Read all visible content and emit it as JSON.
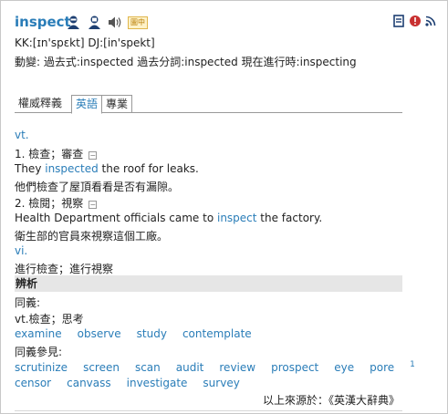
{
  "entry": {
    "headword": "inspect",
    "badge": "圖中",
    "pron": "KK:[ɪn'spɛkt] DJ:[in'spekt]",
    "inflections": "動變: 過去式:inspected  過去分詞:inspected  現在進行時:inspecting"
  },
  "tabs": [
    "權威釋義",
    "英語",
    "專業"
  ],
  "sense1": {
    "pos": "vt.",
    "def": "1. 檢查；審查",
    "ex_pre": "They ",
    "ex_kw": "inspected",
    "ex_post": " the roof for leaks.",
    "ex_zh": "他們檢查了屋頂看看是否有漏隙。"
  },
  "sense2": {
    "def": "2. 檢閱；視察",
    "ex_pre": "Health Department officials came to ",
    "ex_kw": "inspect",
    "ex_post": " the factory.",
    "ex_zh": "衛生部的官員來視察這個工廠。"
  },
  "sense3": {
    "pos": "vi.",
    "def": "進行檢查；進行視察"
  },
  "analysis": {
    "title": "辨析",
    "syn_label": "同義:",
    "syn_sense": "vt.檢查；思考",
    "syns": [
      "examine",
      "observe",
      "study",
      "contemplate"
    ],
    "see_label": "同義參見:",
    "see1": [
      "scrutinize",
      "screen",
      "scan",
      "audit",
      "review",
      "prospect",
      "eye",
      "pore"
    ],
    "see1_sup": "1",
    "see2": [
      "censor",
      "canvass",
      "investigate",
      "survey"
    ]
  },
  "source": "以上來源於：《英漢大辭典》"
}
